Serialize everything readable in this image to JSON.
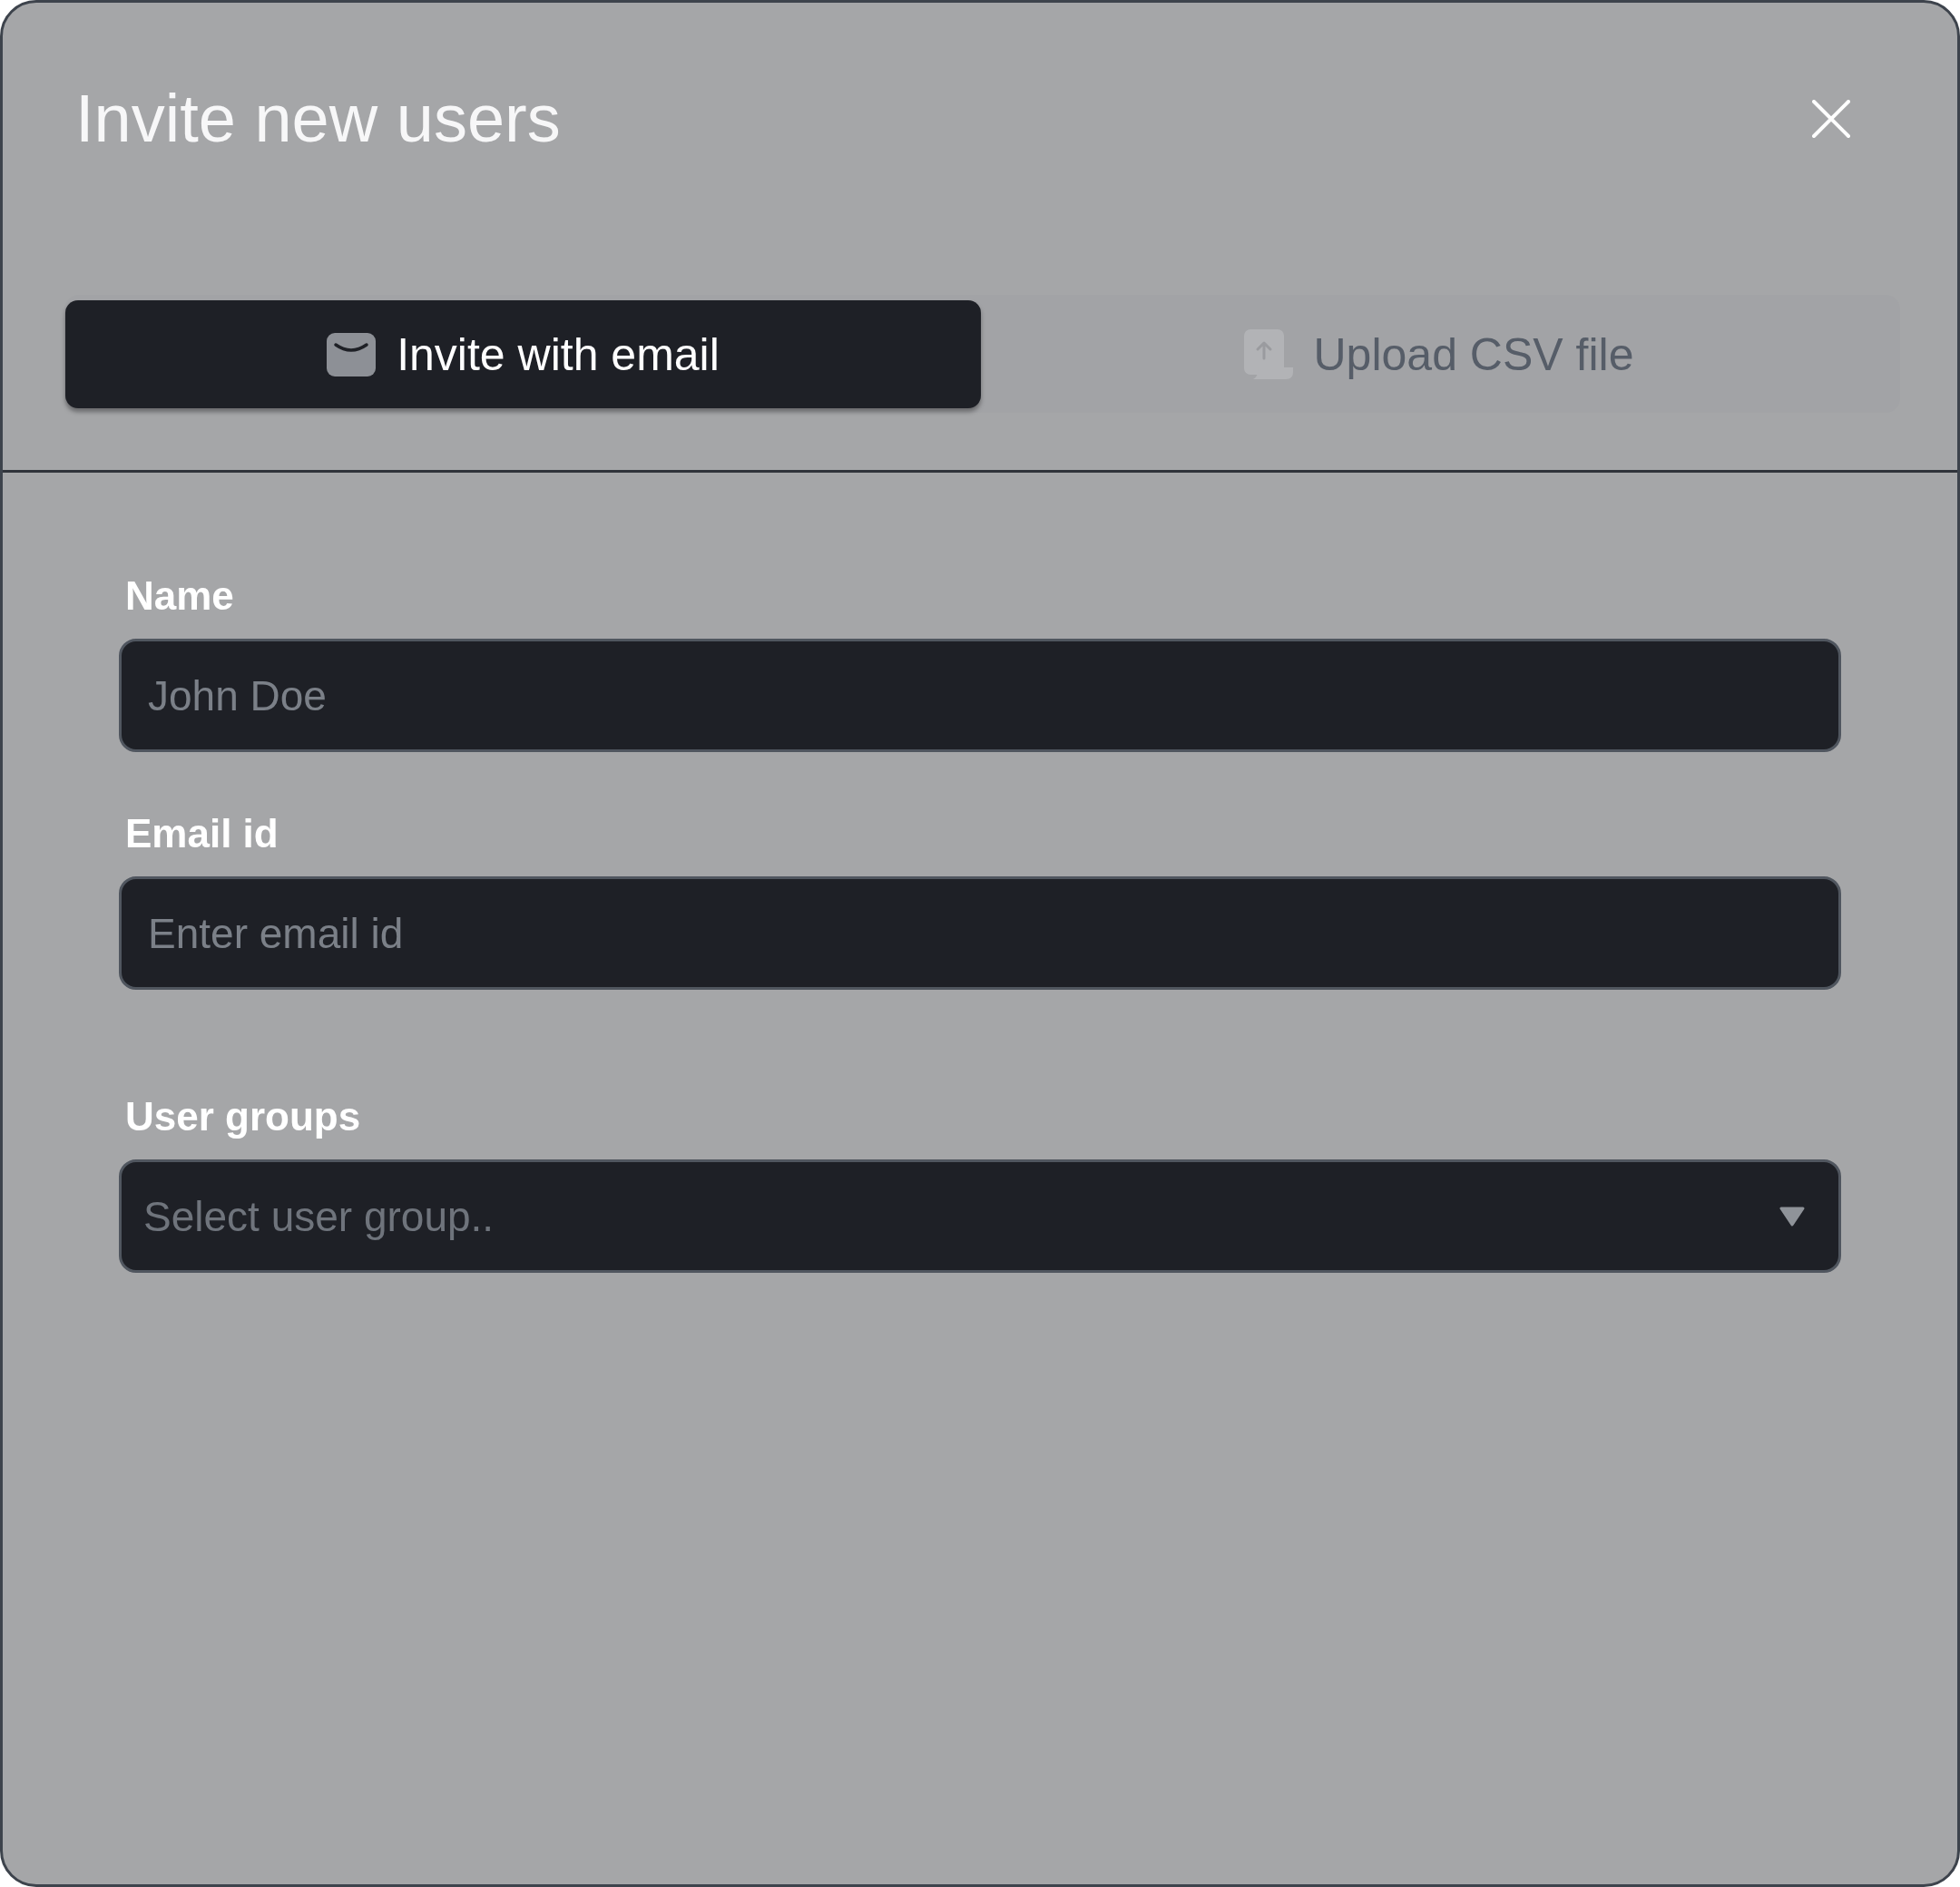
{
  "dialog": {
    "title": "Invite new users"
  },
  "tabs": [
    {
      "kind": "email",
      "label": "Invite with email",
      "selected": true
    },
    {
      "kind": "upload",
      "label": "Upload CSV file",
      "selected": false
    }
  ],
  "fields": [
    {
      "kind": "text",
      "label": "Name",
      "placeholder": "John Doe"
    },
    {
      "kind": "text",
      "label": "Email id",
      "placeholder": "Enter email id"
    },
    {
      "kind": "select",
      "label": "User groups",
      "placeholder": "Select user group.."
    }
  ]
}
